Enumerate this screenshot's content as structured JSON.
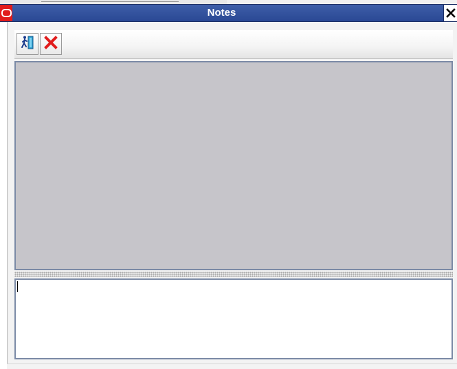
{
  "window": {
    "title": "Notes",
    "app_icon": "oracle-logo-icon",
    "close_icon": "close-icon"
  },
  "toolbar": {
    "exit_icon": "exit-icon",
    "delete_icon": "delete-icon",
    "delete_color": "#e11b1b"
  },
  "notes": {
    "history_text": "",
    "entry_value": ""
  },
  "colors": {
    "titlebar": "#2a4894",
    "history_background": "#c6c5ca",
    "panel_border": "#7b8aa6"
  }
}
